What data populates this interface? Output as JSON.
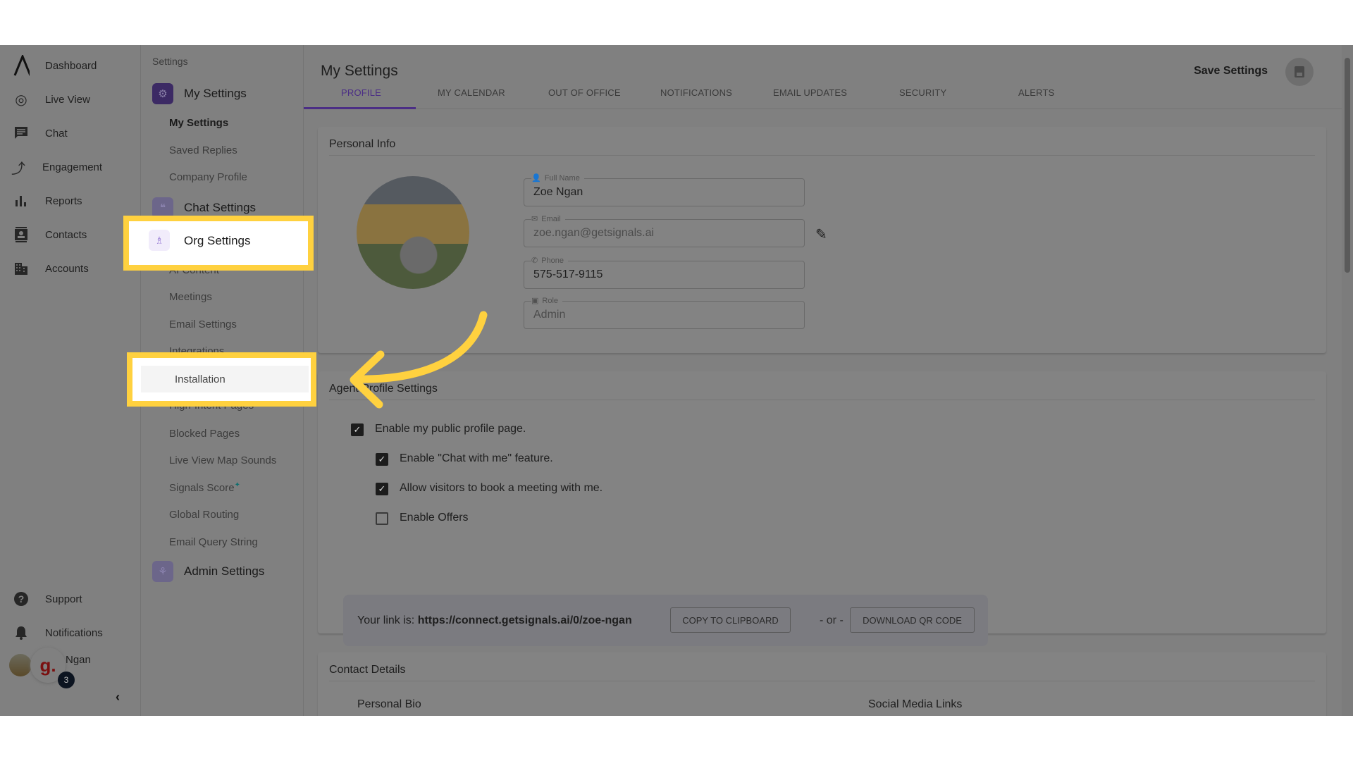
{
  "nav": {
    "items": [
      {
        "label": "Dashboard",
        "icon": "logo-icon"
      },
      {
        "label": "Live View",
        "icon": "globe-search-icon"
      },
      {
        "label": "Chat",
        "icon": "chat-icon"
      },
      {
        "label": "Engagement",
        "icon": "route-icon"
      },
      {
        "label": "Reports",
        "icon": "bar-chart-icon"
      },
      {
        "label": "Contacts",
        "icon": "contacts-icon"
      },
      {
        "label": "Accounts",
        "icon": "building-icon"
      }
    ],
    "bottom": [
      {
        "label": "Support",
        "icon": "help-icon"
      },
      {
        "label": "Notifications",
        "icon": "bell-icon"
      }
    ],
    "user_name": "Ngan",
    "badge_count": "3",
    "widget_logo": "g."
  },
  "settings_menu": {
    "title": "Settings",
    "my_settings": {
      "label": "My Settings",
      "items": [
        "My Settings",
        "Saved Replies",
        "Company Profile"
      ]
    },
    "chat_settings": {
      "label": "Chat Settings"
    },
    "org_settings": {
      "label": "Org Settings",
      "items": [
        "AI Content",
        "Meetings",
        "Email Settings",
        "Integrations",
        "Installation",
        "High-Intent Pages",
        "Blocked Pages",
        "Live View Map Sounds",
        "Signals Score",
        "Global Routing",
        "Email Query String"
      ]
    },
    "signals_score_mark": "✦",
    "admin_settings": {
      "label": "Admin Settings"
    }
  },
  "header": {
    "title": "My Settings",
    "save_label": "Save Settings",
    "tabs": [
      "PROFILE",
      "MY CALENDAR",
      "OUT OF OFFICE",
      "NOTIFICATIONS",
      "EMAIL UPDATES",
      "SECURITY",
      "ALERTS"
    ],
    "active_tab": "PROFILE"
  },
  "personal_info": {
    "title": "Personal Info",
    "fields": [
      {
        "label": "Full Name",
        "value": "Zoe Ngan",
        "icon": "person-icon"
      },
      {
        "label": "Email",
        "value": "zoe.ngan@getsignals.ai",
        "icon": "mail-icon"
      },
      {
        "label": "Phone",
        "value": "575-517-9115",
        "icon": "phone-icon"
      },
      {
        "label": "Role",
        "value": "Admin",
        "icon": "briefcase-icon"
      }
    ]
  },
  "agent_profile": {
    "title": "Agent Profile Settings",
    "options": [
      {
        "label": "Enable my public profile page.",
        "checked": true
      },
      {
        "label": "Enable \"Chat with me\" feature.",
        "checked": true
      },
      {
        "label": "Allow visitors to book a meeting with me.",
        "checked": true
      },
      {
        "label": "Enable Offers",
        "checked": false
      }
    ],
    "link_prefix": "Your link is:",
    "link": "https://connect.getsignals.ai/0/zoe-ngan",
    "copy_label": "COPY TO CLIPBOARD",
    "or_label": "- or -",
    "qr_label": "DOWNLOAD QR CODE"
  },
  "contact_details": {
    "title": "Contact Details",
    "bio_label": "Personal Bio",
    "social_label": "Social Media Links"
  },
  "colors": {
    "highlight": "#ffd13f",
    "accent": "#5b3f95",
    "overlay": "#808080"
  }
}
